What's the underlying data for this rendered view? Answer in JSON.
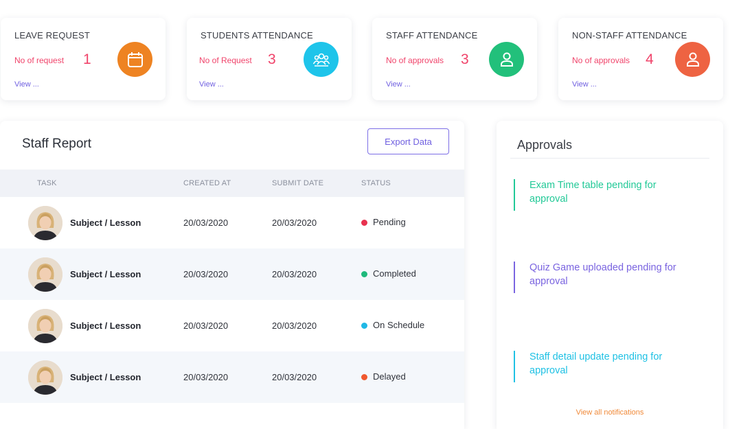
{
  "stat_cards": [
    {
      "title": "LEAVE  REQUEST",
      "label": "No of request",
      "count": "1",
      "link": "View ...",
      "icon": "calendar-icon",
      "color": "#ee8322"
    },
    {
      "title": "STUDENTS ATTENDANCE",
      "label": "No of Request",
      "count": "3",
      "link": "View ...",
      "icon": "group-users-icon",
      "color": "#1ec4ea"
    },
    {
      "title": "STAFF ATTENDANCE",
      "label": "No of approvals",
      "count": "3",
      "link": "View ...",
      "icon": "user-icon",
      "color": "#22c07b"
    },
    {
      "title": "NON-STAFF ATTENDANCE",
      "label": "No of approvals",
      "count": "4",
      "link": "View ...",
      "icon": "user-icon",
      "color": "#ee6342"
    }
  ],
  "report": {
    "title": "Staff Report",
    "export_label": "Export Data",
    "columns": [
      "TASK",
      "CREATED AT",
      "SUBMIT DATE",
      "STATUS"
    ],
    "rows": [
      {
        "task": "Subject / Lesson",
        "created": "20/03/2020",
        "submit": "20/03/2020",
        "status": "Pending",
        "status_color": "#e8324f"
      },
      {
        "task": "Subject / Lesson",
        "created": "20/03/2020",
        "submit": "20/03/2020",
        "status": "Completed",
        "status_color": "#1fb97c"
      },
      {
        "task": "Subject / Lesson",
        "created": "20/03/2020",
        "submit": "20/03/2020",
        "status": "On Schedule",
        "status_color": "#1fb8e6"
      },
      {
        "task": "Subject / Lesson",
        "created": "20/03/2020",
        "submit": "20/03/2020",
        "status": "Delayed",
        "status_color": "#f0582e"
      }
    ]
  },
  "approvals": {
    "title": "Approvals",
    "items": [
      {
        "text": "Exam Time table pending for approval",
        "color": "#22c997"
      },
      {
        "text": "Quiz Game uploaded pending for approval",
        "color": "#7a64e0"
      },
      {
        "text": "Staff detail update pending for approval",
        "color": "#1fc1e4"
      }
    ],
    "view_all": "View all notifications"
  }
}
